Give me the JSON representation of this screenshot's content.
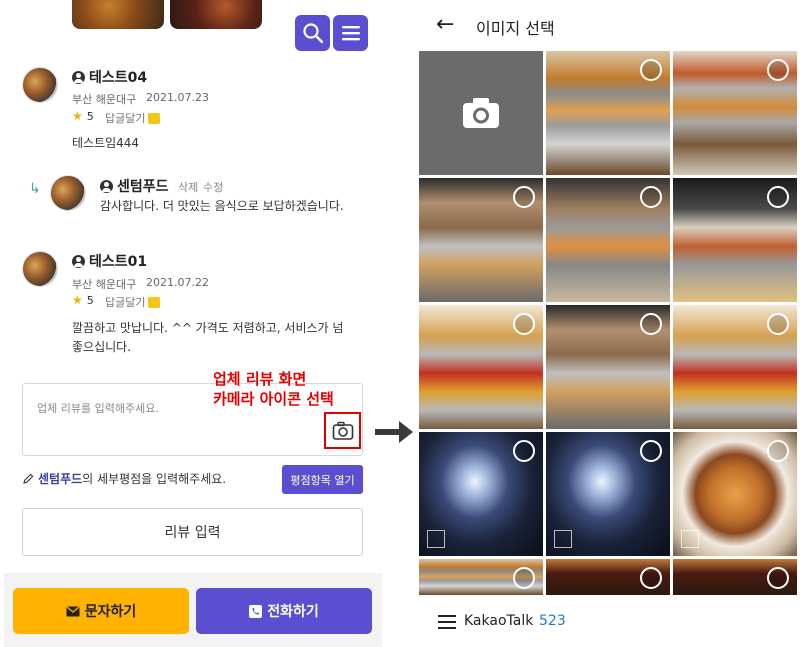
{
  "left": {
    "search_icon": "search-icon",
    "menu_icon": "menu-icon",
    "reviews": [
      {
        "name": "테스트04",
        "location": "부산 해운대구",
        "date": "2021.07.23",
        "rating": "5",
        "reply_label": "답글달기",
        "text": "테스트임444",
        "reply": {
          "name": "센텀푸드",
          "delete_label": "삭제",
          "edit_label": "수정",
          "text": "감사합니다. 더 맛있는 음식으로 보답하겠습니다."
        }
      },
      {
        "name": "테스트01",
        "location": "부산 해운대구",
        "date": "2021.07.22",
        "rating": "5",
        "reply_label": "답글달기",
        "text_line1": "깔끔하고 맛납니다. ^^ 가격도 저렴하고, 서비스가 넘",
        "text_line2": "좋으십니다."
      }
    ],
    "review_input": {
      "placeholder": "업체 리뷰를 입력해주세요."
    },
    "annotation": {
      "line1": "업체 리뷰 화면",
      "line2": "카메라 아이콘 선택"
    },
    "rating_prompt": {
      "company": "센텀푸드",
      "suffix": "의 세부평점을 입력해주세요."
    },
    "open_ratings_label": "평점항목 열기",
    "submit_label": "리뷰 입력",
    "message_label": "문자하기",
    "call_label": "전화하기"
  },
  "right": {
    "title": "이미지 선택",
    "footer_app": "KakaoTalk",
    "footer_count": "523"
  }
}
